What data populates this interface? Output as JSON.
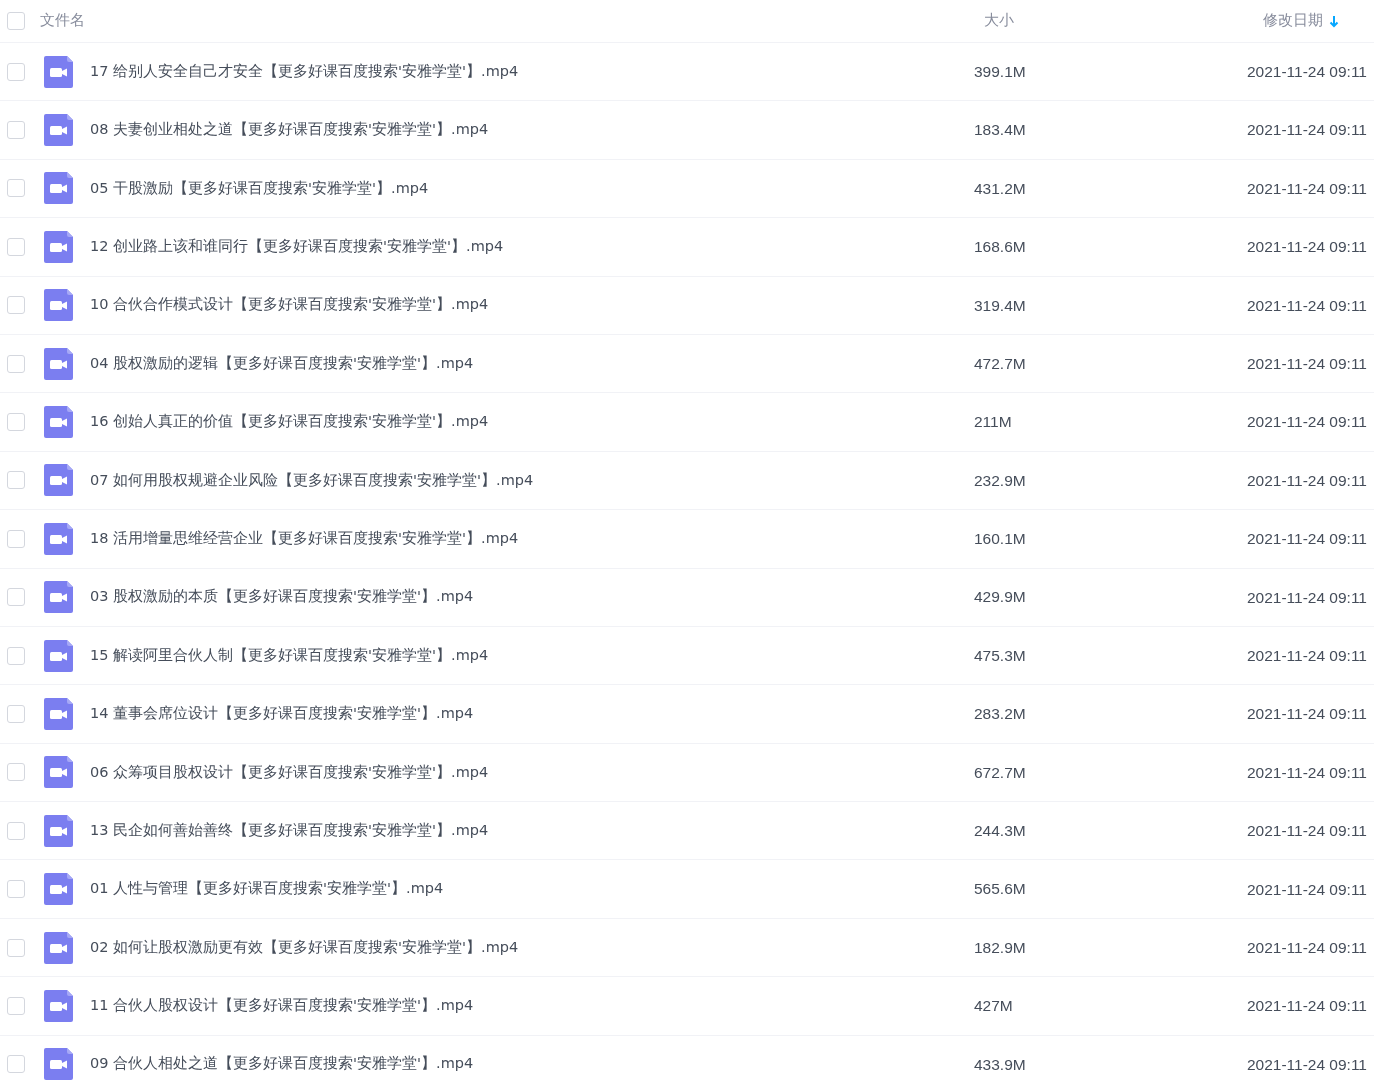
{
  "header": {
    "checked": false,
    "columns": [
      {
        "label": "文件名",
        "sorted": false
      },
      {
        "label": "大小",
        "sorted": false
      },
      {
        "label": "修改日期",
        "sorted": true
      }
    ]
  },
  "files": [
    {
      "name": "17 给别人安全自己才安全【更多好课百度搜索'安雅学堂'】.mp4",
      "size": "399.1M",
      "modified": "2021-11-24 09:11",
      "checked": false,
      "kind": "video"
    },
    {
      "name": "08 夫妻创业相处之道【更多好课百度搜索'安雅学堂'】.mp4",
      "size": "183.4M",
      "modified": "2021-11-24 09:11",
      "checked": false,
      "kind": "video"
    },
    {
      "name": "05 干股激励【更多好课百度搜索'安雅学堂'】.mp4",
      "size": "431.2M",
      "modified": "2021-11-24 09:11",
      "checked": false,
      "kind": "video"
    },
    {
      "name": "12 创业路上该和谁同行【更多好课百度搜索'安雅学堂'】.mp4",
      "size": "168.6M",
      "modified": "2021-11-24 09:11",
      "checked": false,
      "kind": "video"
    },
    {
      "name": "10 合伙合作模式设计【更多好课百度搜索'安雅学堂'】.mp4",
      "size": "319.4M",
      "modified": "2021-11-24 09:11",
      "checked": false,
      "kind": "video"
    },
    {
      "name": "04 股权激励的逻辑【更多好课百度搜索'安雅学堂'】.mp4",
      "size": "472.7M",
      "modified": "2021-11-24 09:11",
      "checked": false,
      "kind": "video"
    },
    {
      "name": "16 创始人真正的价值【更多好课百度搜索'安雅学堂'】.mp4",
      "size": "211M",
      "modified": "2021-11-24 09:11",
      "checked": false,
      "kind": "video"
    },
    {
      "name": "07 如何用股权规避企业风险【更多好课百度搜索'安雅学堂'】.mp4",
      "size": "232.9M",
      "modified": "2021-11-24 09:11",
      "checked": false,
      "kind": "video"
    },
    {
      "name": "18 活用增量思维经营企业【更多好课百度搜索'安雅学堂'】.mp4",
      "size": "160.1M",
      "modified": "2021-11-24 09:11",
      "checked": false,
      "kind": "video"
    },
    {
      "name": "03 股权激励的本质【更多好课百度搜索'安雅学堂'】.mp4",
      "size": "429.9M",
      "modified": "2021-11-24 09:11",
      "checked": false,
      "kind": "video"
    },
    {
      "name": "15 解读阿里合伙人制【更多好课百度搜索'安雅学堂'】.mp4",
      "size": "475.3M",
      "modified": "2021-11-24 09:11",
      "checked": false,
      "kind": "video"
    },
    {
      "name": "14 董事会席位设计【更多好课百度搜索'安雅学堂'】.mp4",
      "size": "283.2M",
      "modified": "2021-11-24 09:11",
      "checked": false,
      "kind": "video"
    },
    {
      "name": "06 众筹项目股权设计【更多好课百度搜索'安雅学堂'】.mp4",
      "size": "672.7M",
      "modified": "2021-11-24 09:11",
      "checked": false,
      "kind": "video"
    },
    {
      "name": "13 民企如何善始善终【更多好课百度搜索'安雅学堂'】.mp4",
      "size": "244.3M",
      "modified": "2021-11-24 09:11",
      "checked": false,
      "kind": "video"
    },
    {
      "name": "01 人性与管理【更多好课百度搜索'安雅学堂'】.mp4",
      "size": "565.6M",
      "modified": "2021-11-24 09:11",
      "checked": false,
      "kind": "video"
    },
    {
      "name": "02 如何让股权激励更有效【更多好课百度搜索'安雅学堂'】.mp4",
      "size": "182.9M",
      "modified": "2021-11-24 09:11",
      "checked": false,
      "kind": "video"
    },
    {
      "name": "11 合伙人股权设计【更多好课百度搜索'安雅学堂'】.mp4",
      "size": "427M",
      "modified": "2021-11-24 09:11",
      "checked": false,
      "kind": "video"
    },
    {
      "name": "09 合伙人相处之道【更多好课百度搜索'安雅学堂'】.mp4",
      "size": "433.9M",
      "modified": "2021-11-24 09:11",
      "checked": false,
      "kind": "video"
    }
  ]
}
